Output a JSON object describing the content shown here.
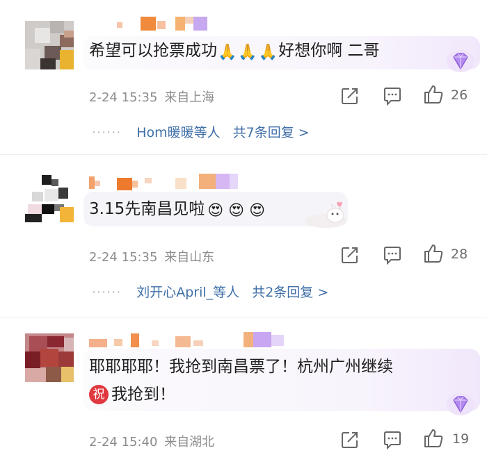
{
  "comments": [
    {
      "text": "希望可以抢票成功",
      "emoji_glyph": "🙏",
      "text_after": "好想你啊 二哥",
      "date": "2-24 15:35",
      "location": "来自上海",
      "likes": "26",
      "replies_text": "Hom暖暖等人",
      "replies_count": "共7条回复 >"
    },
    {
      "text": "3.15先南昌见啦",
      "emoji_glyph": "😍",
      "date": "2-24 15:35",
      "location": "来自山东",
      "likes": "28",
      "replies_text": "刘开心April_等人",
      "replies_count": "共2条回复 >"
    },
    {
      "text": "耶耶耶耶！我抢到南昌票了！杭州广州继续",
      "badge": "祝",
      "text_line2": "我抢到！",
      "date": "2-24 15:40",
      "location": "来自湖北",
      "likes": "19"
    }
  ],
  "ui": {
    "dots": "······",
    "icons": [
      "repost-icon",
      "comment-icon",
      "like-icon",
      "vip-diamond-icon",
      "sticker-icon"
    ],
    "colors": {
      "link": "#3f6fa8",
      "meta": "#8c8c8c",
      "vip": "#a67be6"
    }
  }
}
